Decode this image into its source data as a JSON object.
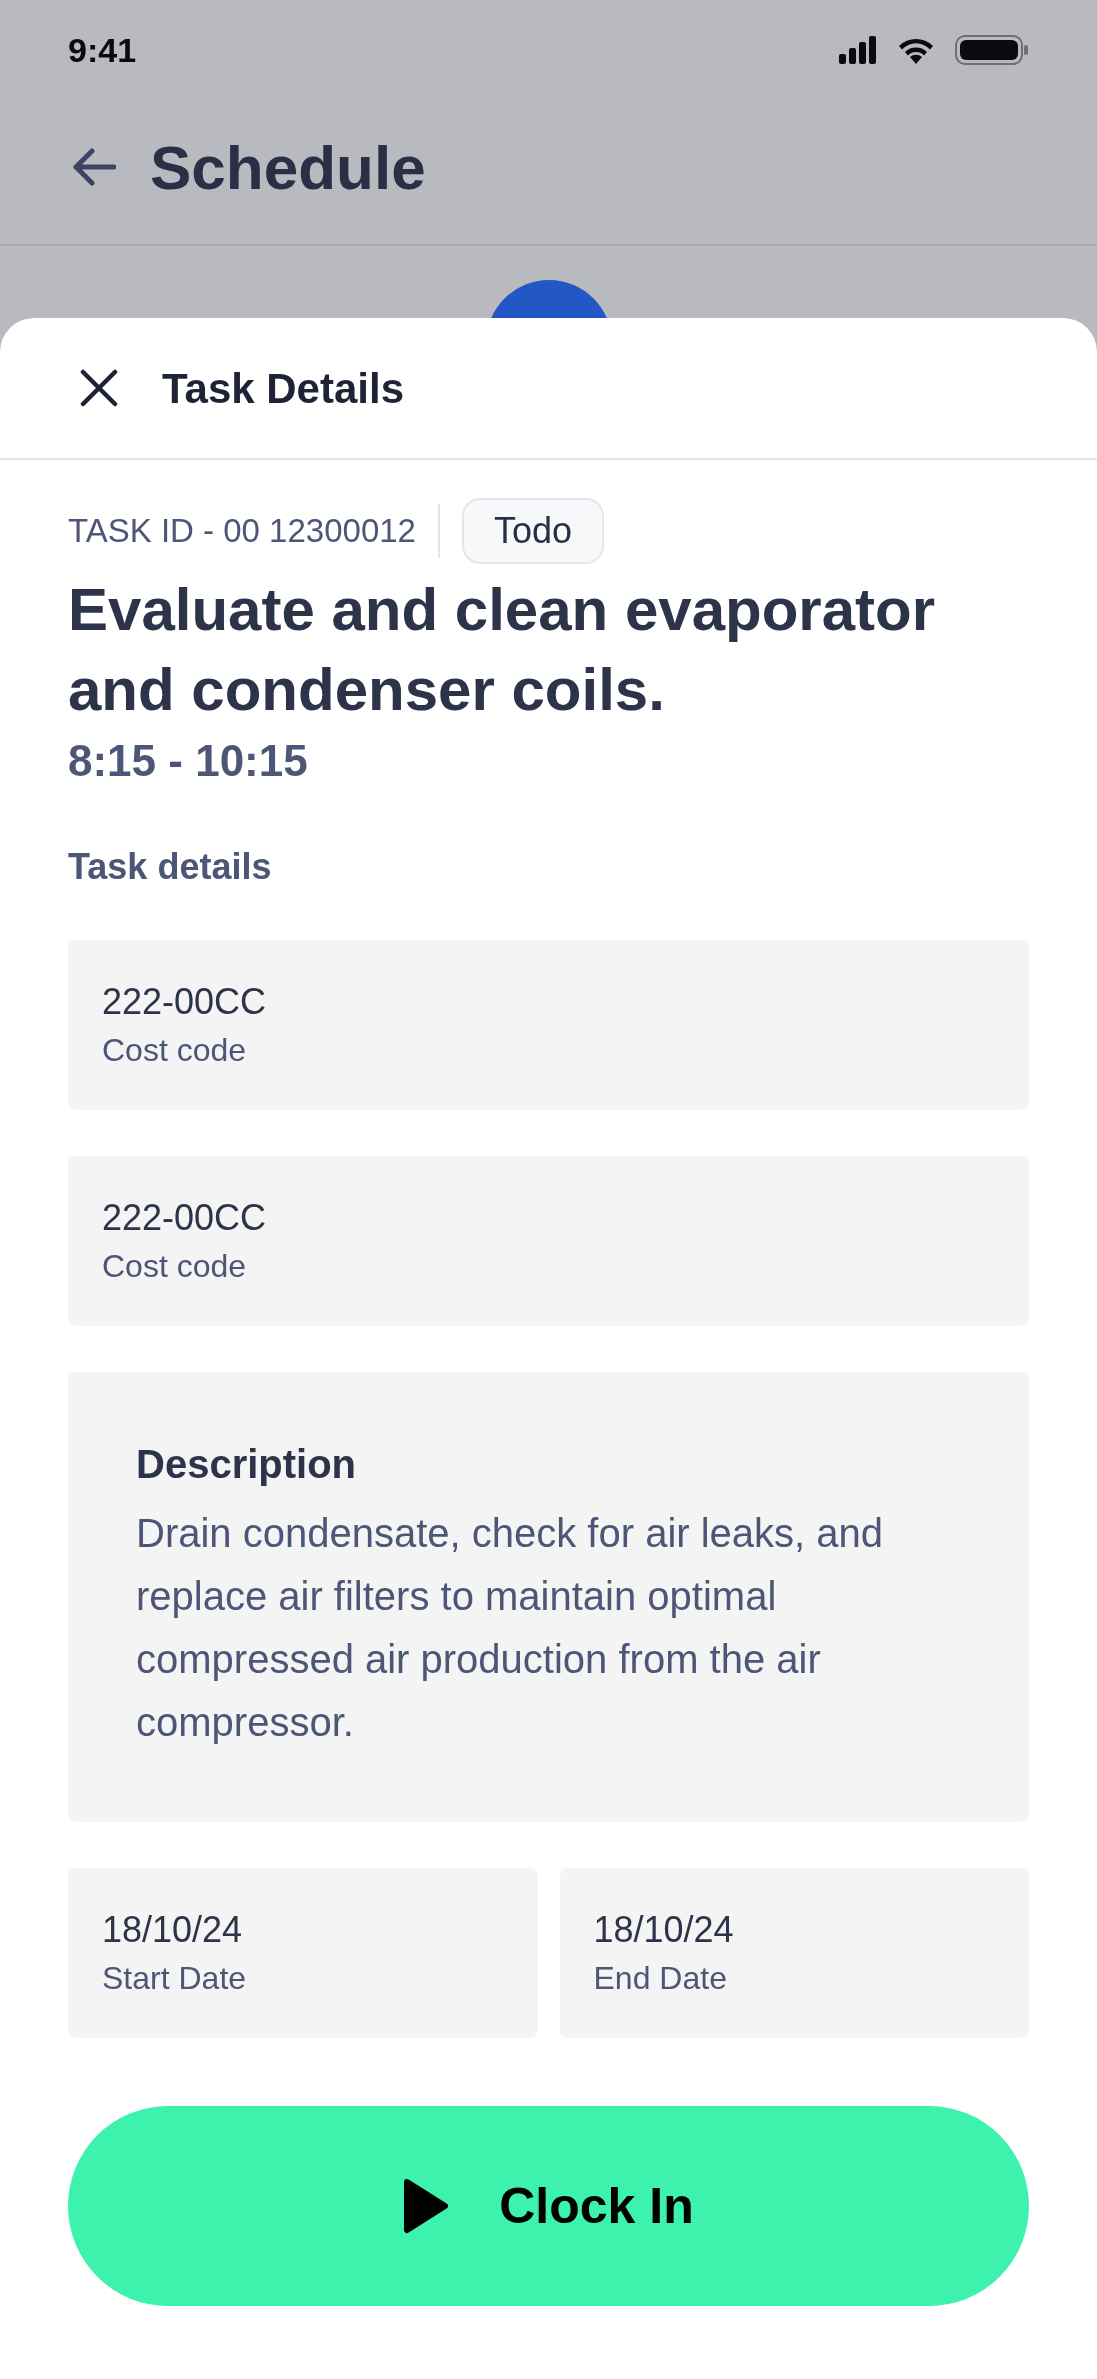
{
  "status_bar": {
    "time": "9:41"
  },
  "header": {
    "title": "Schedule"
  },
  "day_strip": {
    "selected_marker": true
  },
  "sheet": {
    "title": "Task Details"
  },
  "task": {
    "id": "TASK ID - 00 12300012",
    "status": "Todo",
    "title": "Evaluate and clean evaporator and condenser coils.",
    "time": "8:15 - 10:15"
  },
  "section_title": "Task details",
  "fields": [
    {
      "value": "222-00CC",
      "label": "Cost code"
    },
    {
      "value": "222-00CC",
      "label": "Cost code"
    }
  ],
  "description": {
    "title": "Description",
    "text": "Drain condensate, check for air leaks, and replace air filters to maintain optimal compressed air production from the air compressor."
  },
  "dates": [
    {
      "value": "18/10/24",
      "label": "Start Date"
    },
    {
      "value": "18/10/24",
      "label": "End Date"
    }
  ],
  "action_button": {
    "label": "Clock In"
  }
}
